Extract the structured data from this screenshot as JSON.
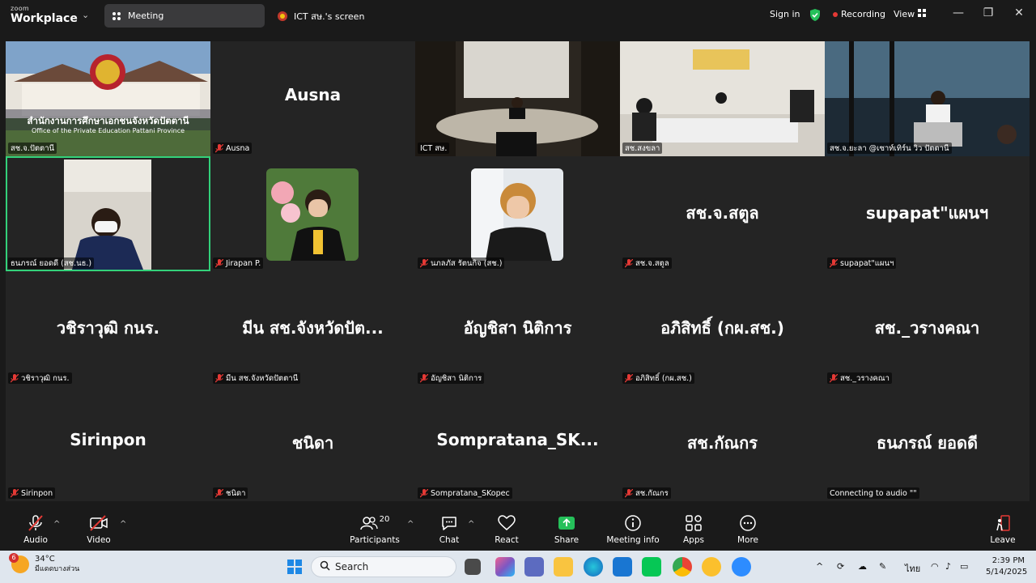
{
  "app": {
    "brand_small": "zoom",
    "brand_big": "Workplace",
    "tabs": [
      {
        "label": "Meeting"
      },
      {
        "label": "ICT สษ.'s screen"
      }
    ],
    "signin": "Sign in",
    "recording": "Recording",
    "view": "View"
  },
  "tiles": [
    {
      "label": "สช.จ.ปัตตานี",
      "big": "",
      "banner_title": "สำนักงานการศึกษาเอกชนจังหวัดปัตตานี",
      "banner_sub": "Office of the Private Education Pattani Province"
    },
    {
      "label": "Ausna",
      "big": "Ausna"
    },
    {
      "label": "ICT สษ.",
      "big": ""
    },
    {
      "label": "สช.สงขลา",
      "big": ""
    },
    {
      "label": "สช.จ.ยะลา @เซาท์เทิร์น วิว ปัตตานี",
      "big": ""
    },
    {
      "label": "ธนภรณ์ ยอดดี (สช.นธ.)",
      "big": ""
    },
    {
      "label": "Jirapan P.",
      "big": ""
    },
    {
      "label": "นภลภัส รัตนกิจ (สช.)",
      "big": ""
    },
    {
      "label": "สช.จ.สตูล",
      "big": "สช.จ.สตูล"
    },
    {
      "label": "supapat\"แผนฯ",
      "big": "supapat\"แผนฯ"
    },
    {
      "label": "วชิราวุฒิ กนร.",
      "big": "วชิราวุฒิ กนร."
    },
    {
      "label": "มีน สช.จังหวัดปัตตานี",
      "big": "มีน สช.จังหวัดปัต..."
    },
    {
      "label": "อัญชิสา นิติการ",
      "big": "อัญชิสา นิติการ"
    },
    {
      "label": "อภิสิทธิ์ (กผ.สช.)",
      "big": "อภิสิทธิ์ (กผ.สช.)"
    },
    {
      "label": "สช._วรางคณา",
      "big": "สช._วรางคณา"
    },
    {
      "label": "Sirinpon",
      "big": "Sirinpon"
    },
    {
      "label": "ชนิดา",
      "big": "ชนิดา"
    },
    {
      "label": "Sompratana_SKopec",
      "big": "Sompratana_SK..."
    },
    {
      "label": "สช.กัณกร",
      "big": "สช.กัณกร"
    },
    {
      "label": "Connecting to audio \"\"",
      "big": "ธนภรณ์ ยอดดี"
    }
  ],
  "toolbar": {
    "audio": "Audio",
    "video": "Video",
    "participants": "Participants",
    "participants_count": "20",
    "chat": "Chat",
    "react": "React",
    "share": "Share",
    "meeting_info": "Meeting info",
    "apps": "Apps",
    "more": "More",
    "leave": "Leave"
  },
  "taskbar": {
    "weather_badge": "6",
    "temp": "34°C",
    "weather_desc": "มีแดดบางส่วน",
    "search": "Search",
    "lang": "ไทย",
    "time": "2:39 PM",
    "date": "5/14/2025"
  },
  "colors": {
    "accent_green": "#33d17a",
    "share_green": "#25c05a",
    "record_red": "#e53935",
    "mic_muted": "#e53935"
  }
}
